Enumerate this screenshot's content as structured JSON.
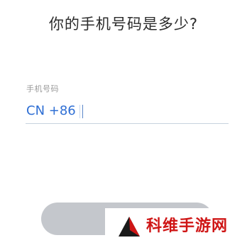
{
  "header": {
    "title": "你的手机号码是多少?"
  },
  "phone_form": {
    "label": "手机号码",
    "country_code": "CN +86",
    "value": ""
  },
  "continue_button": {
    "label": ""
  },
  "watermark": {
    "text": "科维手游网",
    "color": "#cf1616"
  },
  "colors": {
    "accent": "#2f6fd4",
    "button_disabled": "#c4c7cc",
    "title": "#2b2b2b",
    "label": "#9a9a9a"
  }
}
